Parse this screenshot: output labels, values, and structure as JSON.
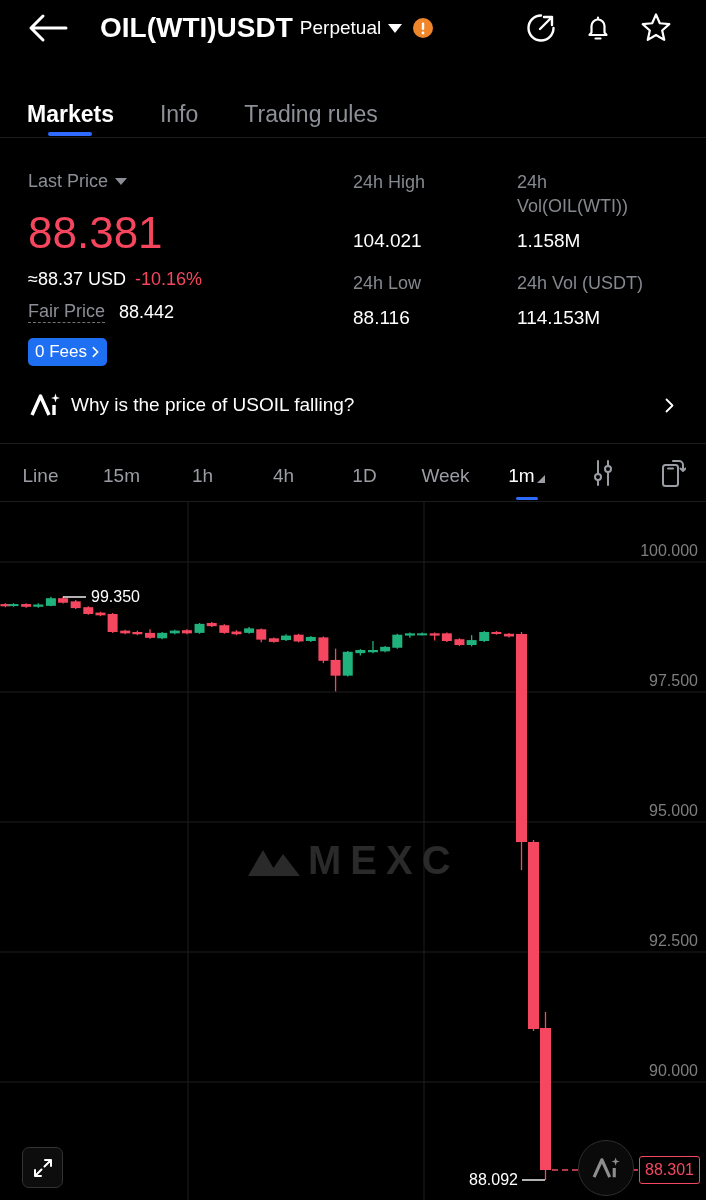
{
  "header": {
    "title": "OIL(WTI)USDT",
    "contract_type": "Perpetual"
  },
  "tabs": [
    {
      "label": "Markets",
      "selected": true
    },
    {
      "label": "Info",
      "selected": false
    },
    {
      "label": "Trading rules",
      "selected": false
    }
  ],
  "price_panel": {
    "last_price_label": "Last Price",
    "last_price": "88.381",
    "usd_price": "≈88.37 USD",
    "change": "-10.16%",
    "fair_price_label": "Fair Price",
    "fair_price": "88.442",
    "fees_button": "0 Fees"
  },
  "stats": [
    {
      "label": "24h High",
      "value": "104.021"
    },
    {
      "label": "24h Vol(OIL(WTI))",
      "value": "1.158M"
    },
    {
      "label": "24h Low",
      "value": "88.116"
    },
    {
      "label": "24h Vol (USDT)",
      "value": "114.153M"
    }
  ],
  "ai_prompt": "Why is the price of USOIL falling?",
  "intervals": [
    {
      "label": "Line",
      "selected": false,
      "kind": "plain"
    },
    {
      "label": "15m",
      "selected": false,
      "kind": "plain"
    },
    {
      "label": "1h",
      "selected": false,
      "kind": "plain"
    },
    {
      "label": "4h",
      "selected": false,
      "kind": "plain"
    },
    {
      "label": "1D",
      "selected": false,
      "kind": "plain"
    },
    {
      "label": "Week",
      "selected": false,
      "kind": "plain"
    },
    {
      "label": "1m",
      "selected": true,
      "kind": "menu"
    }
  ],
  "chart": {
    "watermark": "MEXC",
    "y_axis_labels": [
      "100.000",
      "97.500",
      "95.000",
      "92.500",
      "90.000"
    ],
    "high_marker": "99.350",
    "low_marker": "88.092",
    "last_price_tag": "88.301"
  }
}
